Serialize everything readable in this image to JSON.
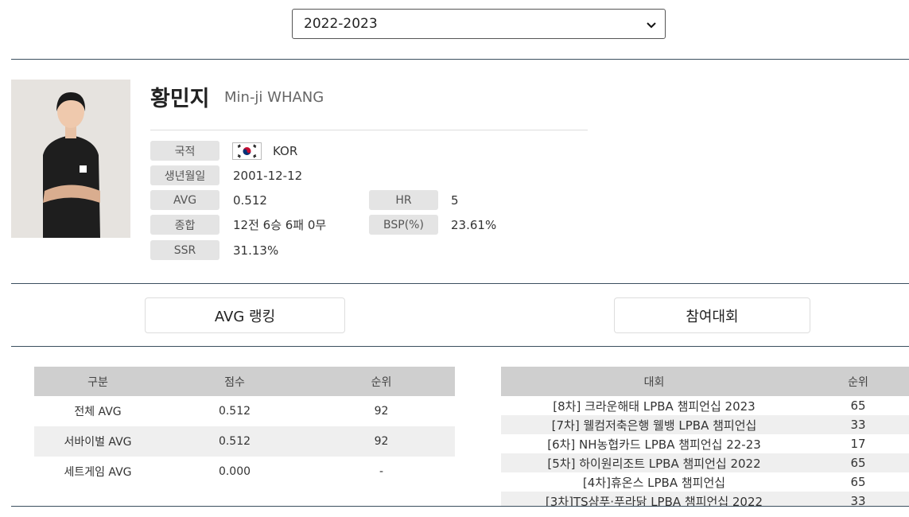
{
  "season": {
    "selected": "2022-2023"
  },
  "player": {
    "name_ko": "황민지",
    "name_en": "Min-ji WHANG",
    "photo": "player-portrait",
    "info": {
      "nationality_label": "국적",
      "nationality_value": "KOR",
      "birth_label": "생년월일",
      "birth_value": "2001-12-12",
      "avg_label": "AVG",
      "avg_value": "0.512",
      "hr_label": "HR",
      "hr_value": "5",
      "record_label": "종합",
      "record_value": "12전 6승 6패 0무",
      "bsp_label": "BSP(%)",
      "bsp_value": "23.61%",
      "ssr_label": "SSR",
      "ssr_value": "31.13%"
    }
  },
  "tabs": {
    "avg_ranking": "AVG 랭킹",
    "tournaments": "참여대회"
  },
  "avg_table": {
    "headers": [
      "구분",
      "점수",
      "순위"
    ],
    "rows": [
      [
        "전체 AVG",
        "0.512",
        "92"
      ],
      [
        "서바이벌 AVG",
        "0.512",
        "92"
      ],
      [
        "세트게임 AVG",
        "0.000",
        "-"
      ]
    ]
  },
  "tour_table": {
    "headers": [
      "대회",
      "순위"
    ],
    "rows": [
      [
        "[8차] 크라운해태 LPBA 챔피언십 2023",
        "65"
      ],
      [
        "[7차] 웰컴저축은행 웰뱅 LPBA 챔피언십",
        "33"
      ],
      [
        "[6차] NH농협카드 LPBA 챔피언십 22-23",
        "17"
      ],
      [
        "[5차] 하이원리조트 LPBA 챔피언십 2022",
        "65"
      ],
      [
        "[4차]휴온스 LPBA 챔피언십",
        "65"
      ],
      [
        "[3차]TS샴푸·푸라닭 LPBA 챔피언십 2022",
        "33"
      ]
    ]
  },
  "colors": {
    "rule": "#3b4f5f",
    "label_bg": "#e4e4e4",
    "header_bg": "#cfcfcf",
    "alt_row": "#efefef"
  }
}
